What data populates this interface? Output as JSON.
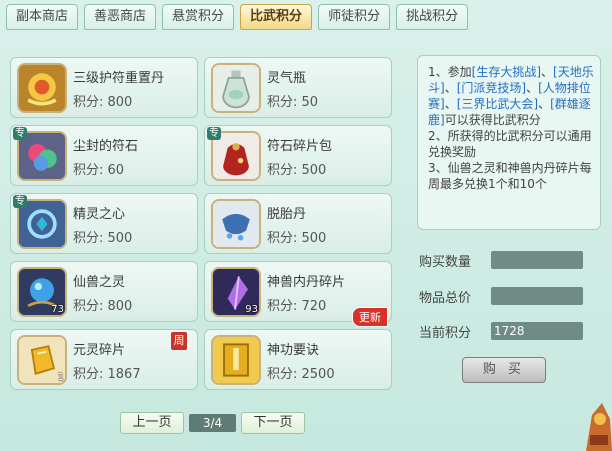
{
  "tabs": [
    "副本商店",
    "善恶商店",
    "悬赏积分",
    "比武积分",
    "师徒积分",
    "挑战积分"
  ],
  "active_tab_index": 3,
  "score_prefix": "积分: ",
  "items": [
    {
      "name": "三级护符重置丹",
      "score": "积分: 800",
      "icon": "gold-amulet-icon"
    },
    {
      "name": "灵气瓶",
      "score": "积分: 50",
      "icon": "spirit-bottle-icon"
    },
    {
      "name": "尘封的符石",
      "score": "积分: 60",
      "icon": "rune-stone-icon",
      "tag": "专"
    },
    {
      "name": "符石碎片包",
      "score": "积分: 500",
      "icon": "rune-bag-icon",
      "tag": "专"
    },
    {
      "name": "精灵之心",
      "score": "积分: 500",
      "icon": "spirit-heart-icon",
      "tag": "专"
    },
    {
      "name": "脱胎丹",
      "score": "积分: 500",
      "icon": "rebirth-pill-icon"
    },
    {
      "name": "仙兽之灵",
      "score": "积分: 800",
      "icon": "beast-spirit-orb-icon",
      "count": "73"
    },
    {
      "name": "神兽内丹碎片",
      "score": "积分: 720",
      "icon": "beast-core-shard-icon",
      "count": "93",
      "badge": "更新"
    },
    {
      "name": "元灵碎片",
      "score": "积分: 1867",
      "icon": "yuanling-shard-icon",
      "count": "1",
      "badge": "周"
    },
    {
      "name": "神功要诀",
      "score": "积分: 2500",
      "icon": "skill-scroll-icon"
    }
  ],
  "description": {
    "l1a": "1、参加",
    "l1b": "[生存大挑战]",
    "l1c": "、",
    "l1d": "[天地乐斗]",
    "l1e": "、",
    "l1f": "[门派竞技场]",
    "l1g": "、",
    "l1h": "[人物排位赛]",
    "l1i": "、",
    "l1j": "[三界比武大会]",
    "l1k": "、",
    "l1l": "[群雄逐鹿]",
    "l1m": "可以获得比武积分",
    "l2": "2、所获得的比武积分可以通用兑换奖励",
    "l3": "3、仙兽之灵和神兽内丹碎片每周最多兑换1个和10个"
  },
  "purchase": {
    "quantity_label": "购买数量",
    "quantity_value": "",
    "total_label": "物品总价",
    "total_value": "",
    "current_label": "当前积分",
    "current_value": "1728",
    "buy_label": "购 买"
  },
  "pager": {
    "prev_label": "上一页",
    "page": "3/4",
    "next_label": "下一页"
  },
  "colors": {
    "accent": "#1f6dc7",
    "active_tab": "#f3d98a",
    "badge_red": "#d9302c"
  }
}
